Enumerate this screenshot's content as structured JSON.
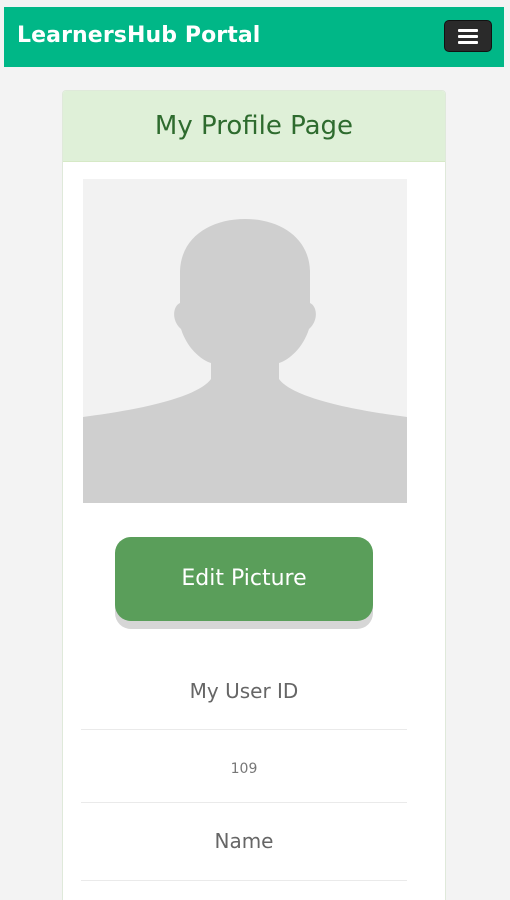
{
  "navbar": {
    "brand": "LearnersHub Portal",
    "menu_icon": "hamburger-icon"
  },
  "profile": {
    "header_title": "My Profile Page",
    "avatar_icon": "user-silhouette-icon",
    "edit_picture_label": "Edit Picture",
    "user_id_label": "My User ID",
    "user_id_value": "109",
    "name_label": "Name"
  },
  "colors": {
    "navbar": "#00b787",
    "header_bg": "#dff0d8",
    "button": "#5a9e5a"
  }
}
